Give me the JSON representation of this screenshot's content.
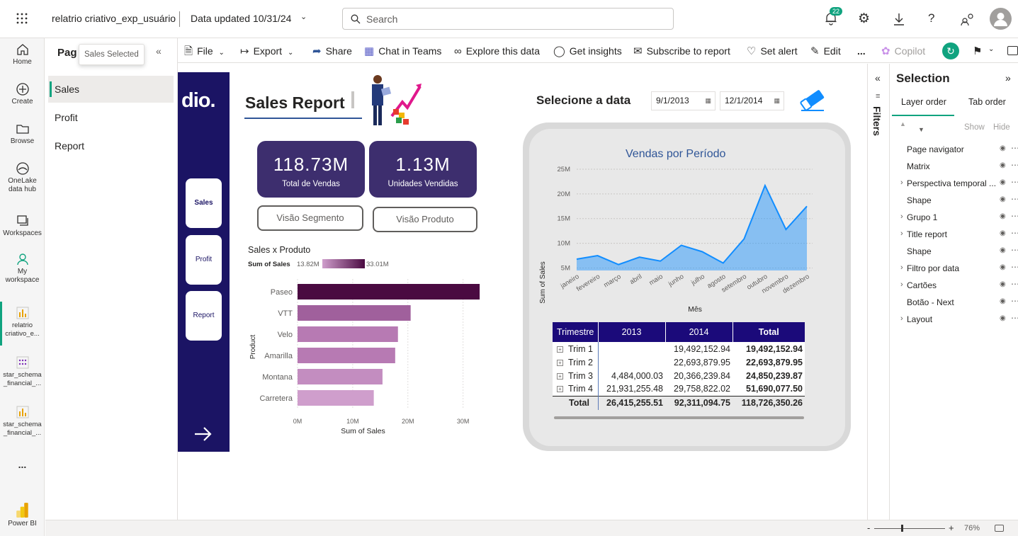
{
  "topbar": {
    "report_name": "relatrio criativo_exp_usuário",
    "data_updated": "Data updated 10/31/24",
    "search_placeholder": "Search",
    "notification_count": "22"
  },
  "rail": {
    "home": "Home",
    "create": "Create",
    "browse": "Browse",
    "onelake": [
      "OneLake",
      "data hub"
    ],
    "workspaces": "Workspaces",
    "my_workspace": [
      "My",
      "workspace"
    ],
    "recent1": [
      "relatrio",
      "criativo_e..."
    ],
    "recent2": [
      "star_schema",
      "_financial_..."
    ],
    "recent3": [
      "star_schema",
      "_financial_..."
    ],
    "more": "...",
    "powerbi": "Power BI"
  },
  "pages": {
    "title": "Pag",
    "tooltip": "Sales Selected",
    "items": [
      "Sales",
      "Profit",
      "Report"
    ]
  },
  "toolbar": {
    "file": "File",
    "export": "Export",
    "share": "Share",
    "chat_in_teams": "Chat in Teams",
    "explore": "Explore this data",
    "insights": "Get insights",
    "subscribe": "Subscribe to report",
    "set_alert": "Set alert",
    "edit": "Edit",
    "more": "...",
    "copilot": "Copilot"
  },
  "report": {
    "logo": "dio.",
    "title": "Sales Report",
    "nav_buttons": [
      "Sales",
      "Profit",
      "Report"
    ],
    "kpis": [
      {
        "value": "118.73M",
        "label": "Total de Vendas"
      },
      {
        "value": "1.13M",
        "label": "Unidades Vendidas"
      }
    ],
    "buttons": [
      "Visão Segmento",
      "Visão Produto"
    ],
    "date_label": "Selecione a data",
    "date_from": "9/1/2013",
    "date_to": "12/1/2014"
  },
  "bar_chart": {
    "title": "Sales x Produto",
    "legend_label": "Sum of  Sales",
    "legend_min": "13.82M",
    "legend_max": "33.01M",
    "ylabel": "Product",
    "xlabel": "Sum of Sales",
    "ticks": [
      "0M",
      "10M",
      "20M",
      "30M"
    ]
  },
  "line_chart": {
    "title": "Vendas por Período",
    "ylabel": "Sum of Sales",
    "xlabel": "Mês",
    "yticks": [
      "25M",
      "20M",
      "15M",
      "10M",
      "5M"
    ]
  },
  "chart_data": [
    {
      "type": "bar",
      "title": "Sales x Produto",
      "xlabel": "Sum of Sales",
      "ylabel": "Product",
      "categories": [
        "Paseo",
        "VTT",
        "Velo",
        "Amarilla",
        "Montana",
        "Carretera"
      ],
      "values": [
        33.01,
        20.5,
        18.2,
        17.7,
        15.4,
        13.82
      ],
      "xlim": [
        0,
        33
      ],
      "unit": "M",
      "colors": [
        "#4a0a41",
        "#a0609c",
        "#b77ab3",
        "#b77ab3",
        "#c38dc0",
        "#cf9ecc"
      ]
    },
    {
      "type": "area",
      "title": "Vendas por Período",
      "xlabel": "Mês",
      "ylabel": "Sum of Sales",
      "categories": [
        "janeiro",
        "fevereiro",
        "março",
        "abril",
        "maio",
        "junho",
        "julho",
        "agosto",
        "setembro",
        "outubro",
        "novembro",
        "dezembro"
      ],
      "values": [
        6.8,
        7.5,
        5.7,
        7.2,
        6.4,
        9.6,
        8.3,
        6.0,
        10.9,
        21.7,
        12.8,
        17.5
      ],
      "ylim": [
        4.5,
        26
      ],
      "unit": "M",
      "grid": true,
      "color": "#118dff"
    }
  ],
  "matrix": {
    "headers": [
      "Trimestre",
      "2013",
      "2014",
      "Total"
    ],
    "rows": [
      [
        "Trim 1",
        "",
        "19,492,152.94",
        "19,492,152.94"
      ],
      [
        "Trim 2",
        "",
        "22,693,879.95",
        "22,693,879.95"
      ],
      [
        "Trim 3",
        "4,484,000.03",
        "20,366,239.84",
        "24,850,239.87"
      ],
      [
        "Trim 4",
        "21,931,255.48",
        "29,758,822.02",
        "51,690,077.50"
      ]
    ],
    "total": [
      "Total",
      "26,415,255.51",
      "92,311,094.75",
      "118,726,350.26"
    ]
  },
  "filters_label": "Filters",
  "selection": {
    "title": "Selection",
    "tabs": [
      "Layer order",
      "Tab order"
    ],
    "show": "Show",
    "hide": "Hide",
    "layers": [
      {
        "name": "Page navigator",
        "group": false
      },
      {
        "name": "Matrix",
        "group": false
      },
      {
        "name": "Perspectiva temporal ...",
        "group": true
      },
      {
        "name": "Shape",
        "group": false
      },
      {
        "name": "Grupo 1",
        "group": true
      },
      {
        "name": "Title report",
        "group": true
      },
      {
        "name": "Shape",
        "group": false
      },
      {
        "name": "Filtro por data",
        "group": true
      },
      {
        "name": "Cartões",
        "group": true
      },
      {
        "name": "Botão - Next",
        "group": false
      },
      {
        "name": "Layout",
        "group": true
      }
    ]
  },
  "status": {
    "zoom_minus": "-",
    "zoom_plus": "+",
    "zoom": "76%",
    "zoom_fraction": 0.38
  },
  "colors": {
    "nav_bg": "#1b1464",
    "kpi_bg": "#3d2e6e",
    "matrix_header": "#1b0a7a",
    "accent_green": "#10a37f",
    "line_area": "#118dff"
  }
}
